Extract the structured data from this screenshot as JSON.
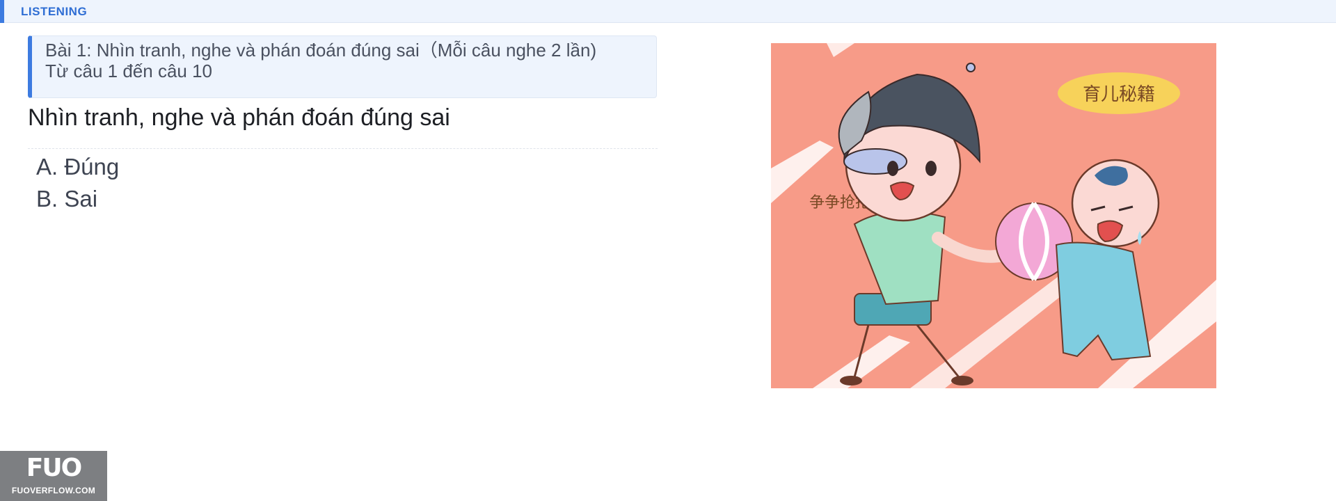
{
  "header": {
    "section_label": "LISTENING"
  },
  "instruction": {
    "line1": "Bài 1: Nhìn tranh, nghe và phán đoán đúng sai（Mỗi câu nghe 2 lần)",
    "line2": "Từ câu 1 đến câu 10"
  },
  "question": {
    "title": "Nhìn tranh, nghe và phán đoán đúng sai"
  },
  "options": [
    {
      "label": "A. Đúng"
    },
    {
      "label": "B. Sai"
    }
  ],
  "picture": {
    "badge_text": "育儿秘籍",
    "caption_text": "争争抢抢",
    "background_color": "#f79b88"
  },
  "watermark": {
    "logo": "FUO",
    "site": "FUOVERFLOW.COM"
  }
}
